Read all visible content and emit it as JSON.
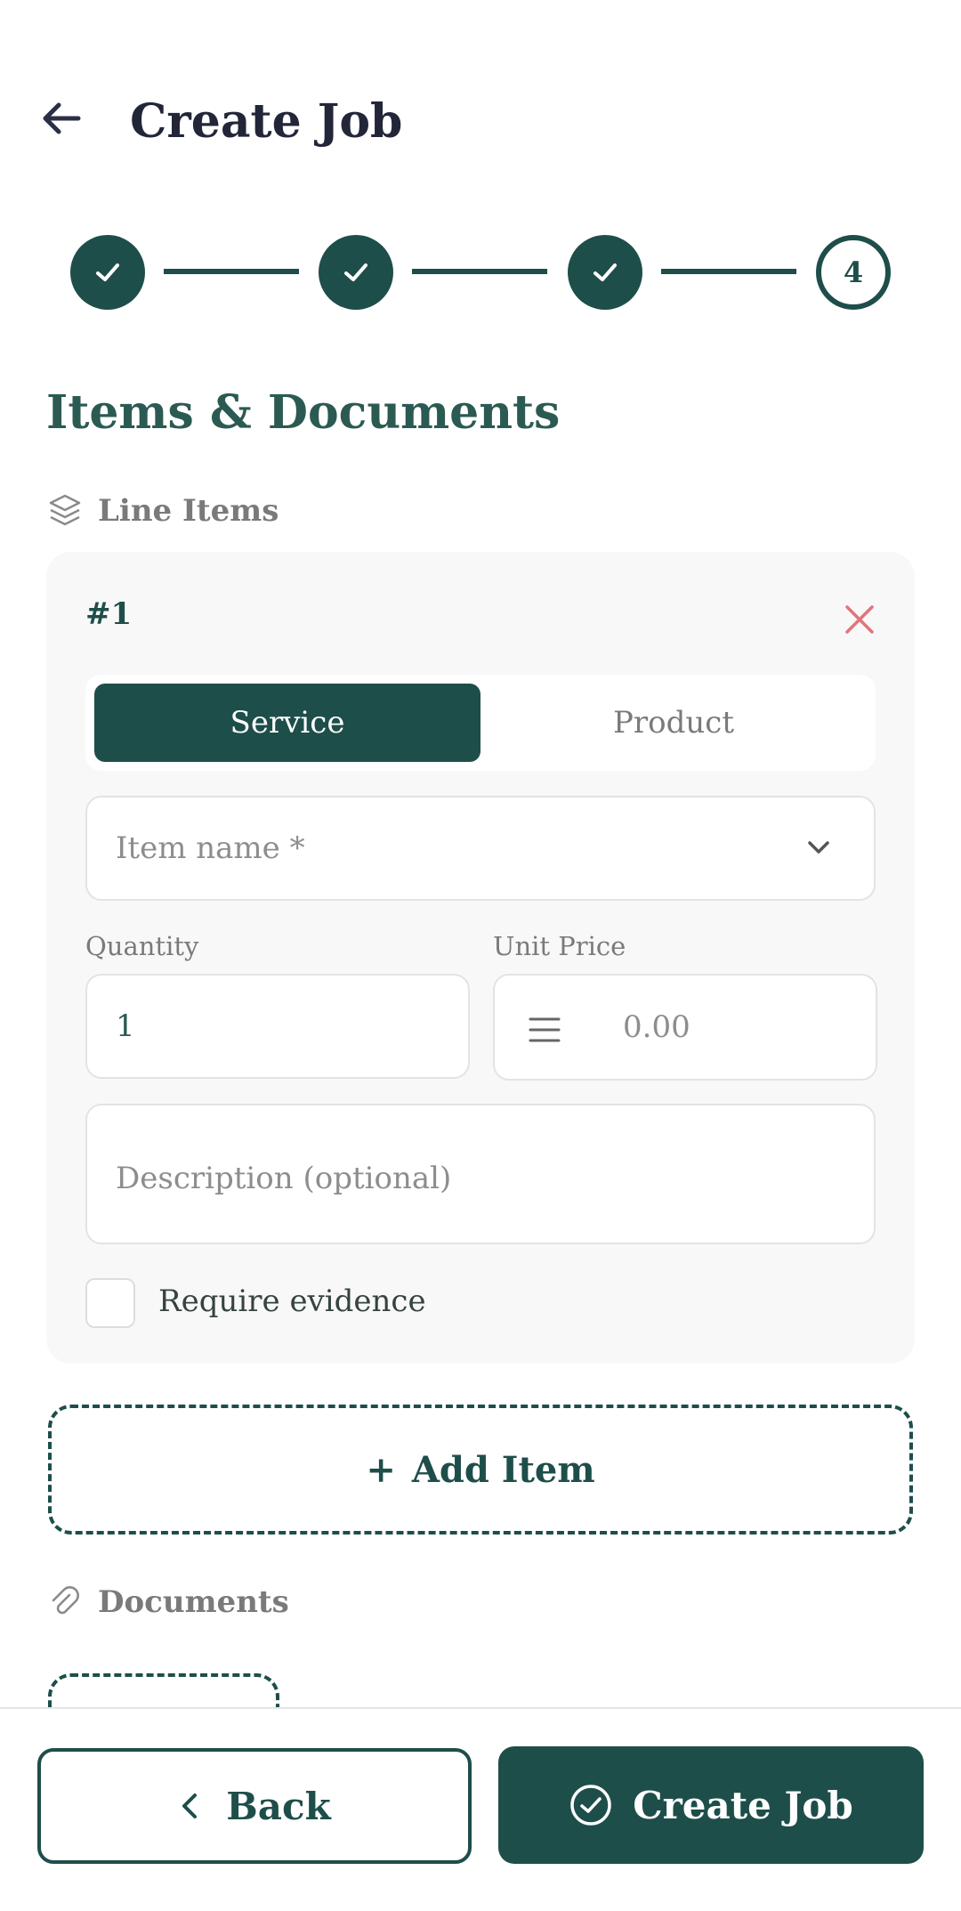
{
  "header": {
    "title": "Create Job",
    "back_icon": "arrow-left-icon"
  },
  "stepper": {
    "steps": [
      {
        "state": "done",
        "icon": "check-icon"
      },
      {
        "state": "done",
        "icon": "check-icon"
      },
      {
        "state": "done",
        "icon": "check-icon"
      },
      {
        "state": "current",
        "label": "4"
      }
    ]
  },
  "section": {
    "title": "Items & Documents"
  },
  "line_items": {
    "label": "Line Items",
    "icon": "layers-icon",
    "items": [
      {
        "number": "#1",
        "type_options": [
          "Service",
          "Product"
        ],
        "selected_type": "Service",
        "item_name_placeholder": "Item name *",
        "quantity_label": "Quantity",
        "quantity_value": "1",
        "unit_price_label": "Unit Price",
        "unit_price_placeholder": "0.00",
        "description_placeholder": "Description (optional)",
        "require_evidence_label": "Require evidence",
        "require_evidence_checked": false
      }
    ],
    "add_item_label": "Add Item",
    "add_item_prefix": "+"
  },
  "documents": {
    "label": "Documents",
    "icon": "paperclip-icon"
  },
  "footer": {
    "back_label": "Back",
    "create_label": "Create Job"
  },
  "colors": {
    "accent": "#1e4e4a",
    "danger": "#e0757a",
    "muted": "#7a7a7a"
  }
}
